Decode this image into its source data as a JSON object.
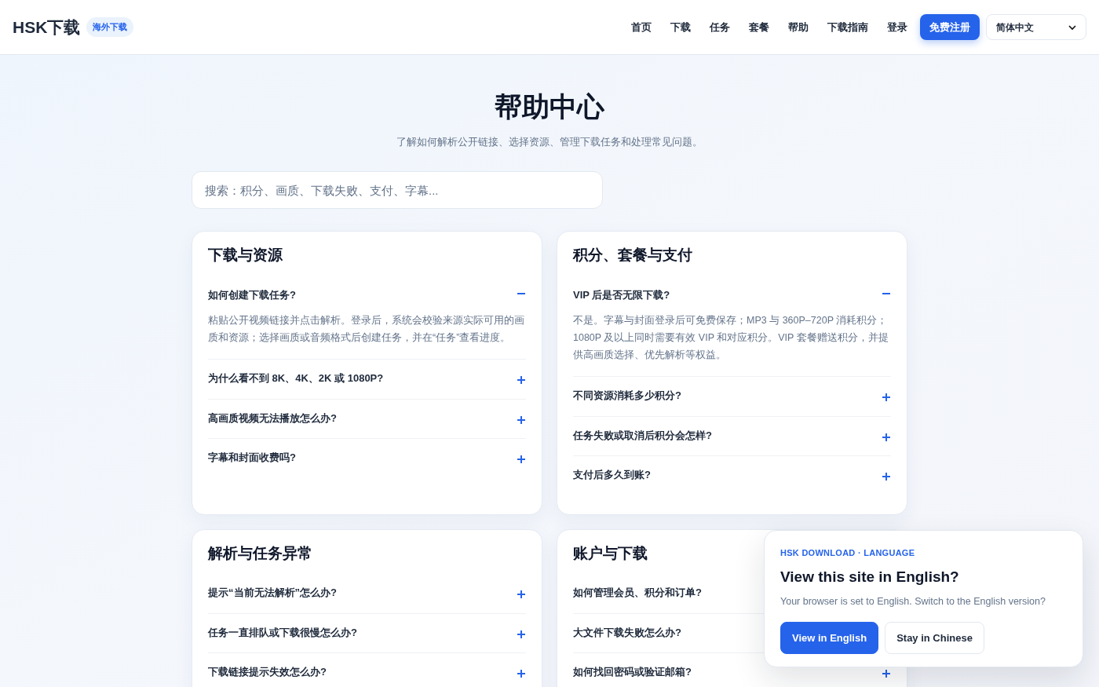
{
  "header": {
    "logo": "HSK下载",
    "badge": "海外下载",
    "nav": [
      "首页",
      "下载",
      "任务",
      "套餐",
      "帮助",
      "下载指南",
      "登录"
    ],
    "register_button": "免费注册",
    "language_select": "简体中文"
  },
  "hero": {
    "title": "帮助中心",
    "subtitle": "了解如何解析公开链接、选择资源、管理下载任务和处理常见问题。",
    "search": {
      "placeholder": "搜索：积分、画质、下载失败、支付、字幕..."
    }
  },
  "sections": [
    {
      "title": "下载与资源",
      "items": [
        {
          "question": "如何创建下载任务?",
          "expanded": true,
          "answer": "粘贴公开视频链接并点击解析。登录后，系统会校验来源实际可用的画质和资源；选择画质或音频格式后创建任务，并在“任务”查看进度。"
        },
        {
          "question": "为什么看不到 8K、4K、2K 或 1080P?",
          "expanded": false
        },
        {
          "question": "高画质视频无法播放怎么办?",
          "expanded": false
        },
        {
          "question": "字幕和封面收费吗?",
          "expanded": false
        }
      ]
    },
    {
      "title": "积分、套餐与支付",
      "items": [
        {
          "question": "VIP 后是否无限下载?",
          "expanded": true,
          "answer": "不是。字幕与封面登录后可免费保存；MP3 与 360P–720P 消耗积分；1080P 及以上同时需要有效 VIP 和对应积分。VIP 套餐赠送积分，并提供高画质选择、优先解析等权益。"
        },
        {
          "question": "不同资源消耗多少积分?",
          "expanded": false
        },
        {
          "question": "任务失败或取消后积分会怎样?",
          "expanded": false
        },
        {
          "question": "支付后多久到账?",
          "expanded": false
        }
      ]
    },
    {
      "title": "解析与任务异常",
      "items": [
        {
          "question": "提示“当前无法解析”怎么办?",
          "expanded": false
        },
        {
          "question": "任务一直排队或下载很慢怎么办?",
          "expanded": false
        },
        {
          "question": "下载链接提示失效怎么办?",
          "expanded": false
        }
      ]
    },
    {
      "title": "账户与下载",
      "items": [
        {
          "question": "如何管理会员、积分和订单?"
        },
        {
          "question": "大文件下载失败怎么办?"
        },
        {
          "question": "如何找回密码或验证邮箱?",
          "expanded": false
        }
      ]
    }
  ],
  "language_popup": {
    "eyebrow": "HSK DOWNLOAD · LANGUAGE",
    "title": "View this site in English?",
    "message": "Your browser is set to English. Switch to the English version?",
    "buttons": [
      {
        "label": "View in English",
        "kind": "primary"
      },
      {
        "label": "Stay in Chinese",
        "kind": "secondary"
      }
    ]
  }
}
